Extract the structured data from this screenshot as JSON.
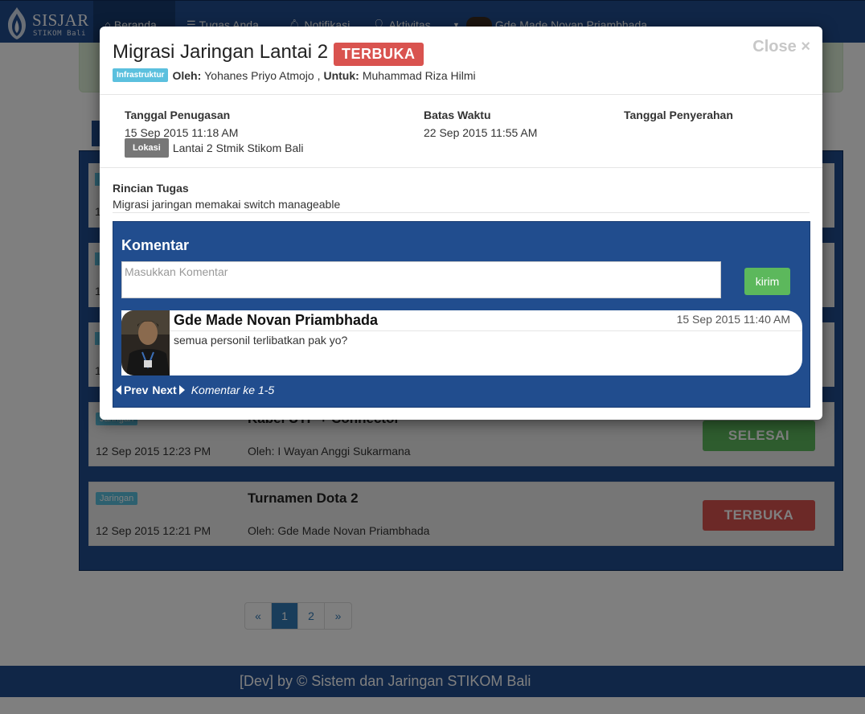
{
  "navbar": {
    "brand_name": "SISJAR",
    "brand_sub": "STIKOM Bali",
    "items": [
      {
        "label": "Beranda",
        "icon": "home-icon"
      },
      {
        "label": "Tugas Anda",
        "icon": "list-icon"
      },
      {
        "label": "Notifikasi",
        "icon": "bell-icon"
      },
      {
        "label": "Aktivitas",
        "icon": "user-icon"
      }
    ],
    "user_name": "Gde Made Novan Priambhada"
  },
  "tasks": [
    {
      "category": "Jaringan",
      "date": "12 Sep 2015 12:23 PM",
      "title": "Kabel UTP + Connector",
      "by": "Oleh: I Wayan Anggi Sukarmana",
      "status": "SELESAI"
    },
    {
      "category": "Jaringan",
      "date": "12 Sep 2015 12:21 PM",
      "title": "Turnamen Dota 2",
      "by": "Oleh: Gde Made Novan Priambhada",
      "status": "TERBUKA"
    }
  ],
  "hidden_rows": [
    {
      "date": "1"
    },
    {
      "date": "1"
    },
    {
      "date": "1"
    }
  ],
  "pagination": {
    "prev": "«",
    "pages": [
      "1",
      "2"
    ],
    "next": "»"
  },
  "footer": {
    "text": "[Dev] by © Sistem dan Jaringan STIKOM Bali"
  },
  "modal": {
    "title": "Migrasi Jaringan Lantai 2",
    "status": "TERBUKA",
    "close_label": "Close ×",
    "category": "Infrastruktur",
    "oleh_label": "Oleh:",
    "oleh_value": "Yohanes Priyo Atmojo ,",
    "untuk_label": "Untuk:",
    "untuk_value": "Muhammad Riza Hilmi",
    "assigned_label": "Tanggal Penugasan",
    "assigned_value": "15 Sep 2015 11:18 AM",
    "deadline_label": "Batas Waktu",
    "deadline_value": "22 Sep 2015 11:55 AM",
    "submitted_label": "Tanggal Penyerahan",
    "location_badge": "Lokasi",
    "location_value": "Lantai 2 Stmik Stikom Bali",
    "details_label": "Rincian Tugas",
    "details_value": "Migrasi jaringan memakai switch manageable",
    "comments": {
      "title": "Komentar",
      "placeholder": "Masukkan Komentar",
      "send_label": "kirim",
      "items": [
        {
          "author": "Gde Made Novan Priambhada",
          "time": "15 Sep 2015 11:40 AM",
          "text": "semua personil terlibatkan pak yo?"
        }
      ],
      "prev_label": "Prev",
      "next_label": "Next",
      "count_label": "Komentar ke 1-5"
    }
  },
  "colors": {
    "primary": "#214d8e",
    "danger": "#d9534f",
    "success": "#5cb85c",
    "info": "#5bc0de"
  }
}
